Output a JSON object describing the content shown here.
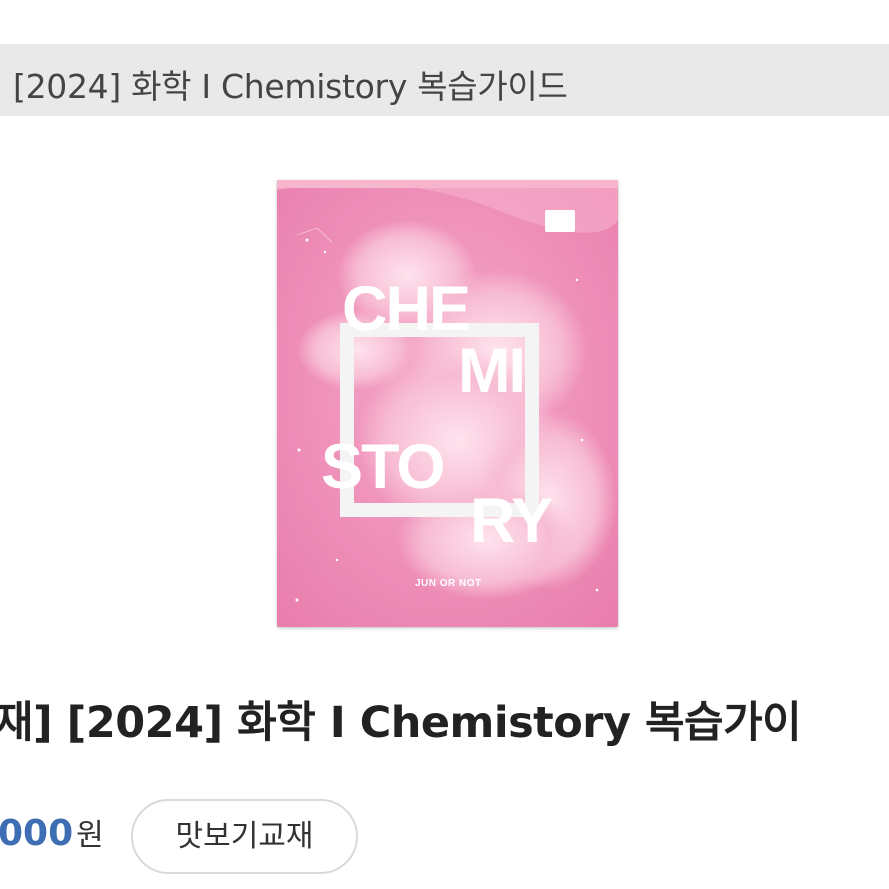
{
  "header": {
    "title": "[2024] 화학 I Chemistory 복습가이드"
  },
  "cover": {
    "title_lines": [
      "CHE",
      "MI",
      "STO",
      "RY"
    ],
    "publisher": "JUN OR NOT",
    "badge_text": "",
    "colors": {
      "background": "#f08fb8",
      "cloud": "#f7c3d8",
      "frame": "#f2f2f2"
    }
  },
  "product": {
    "title": "재] [2024] 화학 I Chemistory 복습가이",
    "price": {
      "amount": "000",
      "unit": "원"
    },
    "sample_button_label": "맛보기교재"
  },
  "colors": {
    "price": "#3d6db3",
    "title_bar": "#e9e9e9"
  }
}
